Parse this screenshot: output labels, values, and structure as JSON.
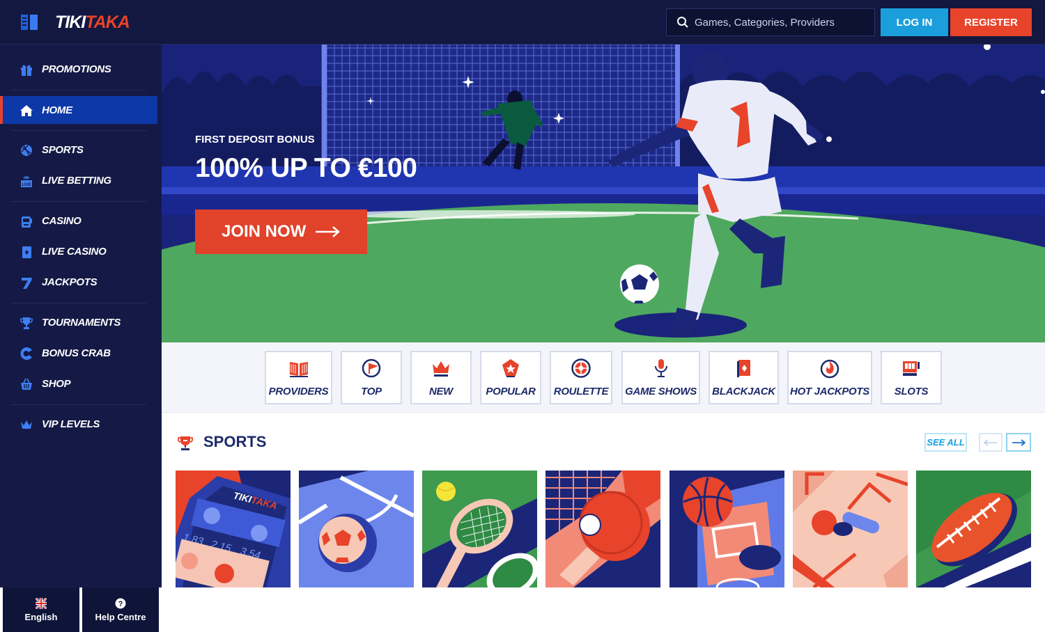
{
  "header": {
    "logo_part1": "TIKI",
    "logo_part2": "TAKA",
    "search_placeholder": "Games, Categories, Providers",
    "login_label": "LOG IN",
    "register_label": "REGISTER"
  },
  "sidebar": {
    "items": [
      {
        "label": "PROMOTIONS",
        "icon": "gift-icon"
      },
      {
        "label": "HOME",
        "icon": "home-icon",
        "active": true
      },
      {
        "label": "SPORTS",
        "icon": "ball-icon"
      },
      {
        "label": "LIVE BETTING",
        "icon": "live-icon"
      },
      {
        "label": "CASINO",
        "icon": "slot-machine-icon"
      },
      {
        "label": "LIVE CASINO",
        "icon": "card-icon"
      },
      {
        "label": "JACKPOTS",
        "icon": "seven-icon"
      },
      {
        "label": "TOURNAMENTS",
        "icon": "trophy-icon"
      },
      {
        "label": "BONUS CRAB",
        "icon": "crab-icon"
      },
      {
        "label": "SHOP",
        "icon": "basket-icon"
      },
      {
        "label": "VIP LEVELS",
        "icon": "crown-icon"
      }
    ],
    "footer": {
      "language_label": "English",
      "help_label": "Help Centre"
    }
  },
  "hero": {
    "subtitle": "FIRST DEPOSIT BONUS",
    "title": "100% UP TO €100",
    "cta_label": "JOIN NOW"
  },
  "categories": [
    {
      "label": "PROVIDERS",
      "icon": "book-icon"
    },
    {
      "label": "TOP",
      "icon": "flag-icon"
    },
    {
      "label": "NEW",
      "icon": "crown-icon"
    },
    {
      "label": "POPULAR",
      "icon": "star-badge-icon"
    },
    {
      "label": "ROULETTE",
      "icon": "roulette-icon"
    },
    {
      "label": "GAME SHOWS",
      "icon": "microphone-icon"
    },
    {
      "label": "BLACKJACK",
      "icon": "playing-card-icon"
    },
    {
      "label": "HOT JACKPOTS",
      "icon": "flame-icon"
    },
    {
      "label": "SLOTS",
      "icon": "slot-icon"
    }
  ],
  "sports_section": {
    "title": "SPORTS",
    "see_all_label": "SEE ALL",
    "tiles": [
      "betting-app",
      "football",
      "tennis",
      "table-tennis",
      "basketball",
      "ice-hockey",
      "american-football"
    ],
    "app_odds": [
      "1.83",
      "2.15",
      "3.54"
    ]
  },
  "colors": {
    "navy": "#141a45",
    "active_blue": "#0c38a8",
    "accent_red": "#e8432b",
    "accent_blue": "#1a9fdc",
    "text_dark": "#1d2a6a"
  }
}
